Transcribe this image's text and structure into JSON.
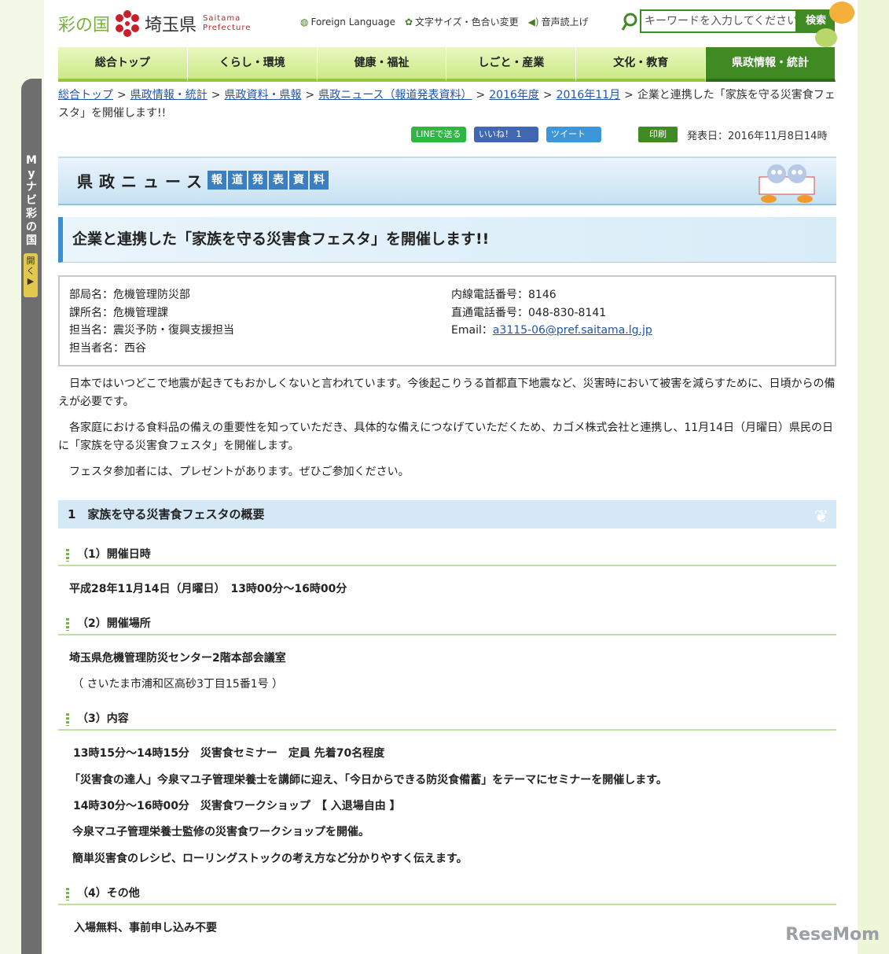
{
  "header": {
    "logo_sainokuni": "彩の国",
    "logo_ken": "埼玉県",
    "logo_en_1": "Saitama",
    "logo_en_2": "Prefecture",
    "util_foreign": "Foreign Language",
    "util_font": "文字サイズ・色合い変更",
    "util_voice": "音声読上げ",
    "search_placeholder": "キーワードを入力してください",
    "search_button": "検索"
  },
  "nav": [
    "総合トップ",
    "くらし・環境",
    "健康・福祉",
    "しごと・産業",
    "文化・教育",
    "県政情報・統計"
  ],
  "side_tab": {
    "label": "Myナビ 彩の国",
    "open": "開く▶"
  },
  "breadcrumb": {
    "items": [
      "総合トップ",
      "県政情報・統計",
      "県政資料・県報",
      "県政ニュース（報道発表資料）",
      "2016年度",
      "2016年11月"
    ],
    "current": "企業と連携した「家族を守る災害食フェスタ」を開催します!!"
  },
  "share": {
    "line": "LINEで送る",
    "fb": "いいね！ 1",
    "tw": "ツイート",
    "print": "印刷",
    "pubdate": "発表日：2016年11月8日14時"
  },
  "banner": {
    "kensei": "県政ニュース",
    "houdou": [
      "報",
      "道",
      "発",
      "表",
      "資",
      "料"
    ]
  },
  "title": "企業と連携した「家族を守る災害食フェスタ」を開催します!!",
  "contact": {
    "dept": "部局名：危機管理防災部",
    "section": "課所名：危機管理課",
    "team": "担当名：震災予防・復興支援担当",
    "person": "担当者名：西谷",
    "ext": "内線電話番号：8146",
    "direct": "直通電話番号：048-830-8141",
    "email_label": "Email：",
    "email": "a3115-06@pref.saitama.lg.jp"
  },
  "body": {
    "p1": "日本ではいつどこで地震が起きてもおかしくないと言われています。今後起こりうる首都直下地震など、災害時において被害を減らすために、日頃からの備えが必要です。",
    "p2": "各家庭における食料品の備えの重要性を知っていただき、具体的な備えにつなげていただくため、カゴメ株式会社と連携し、11月14日（月曜日）県民の日に「家族を守る災害食フェスタ」を開催します。",
    "p3": "フェスタ参加者には、プレゼントがあります。ぜひご参加ください。"
  },
  "section1": {
    "heading": "1　家族を守る災害食フェスタの概要",
    "h_date": "（1）開催日時",
    "date": "平成28年11月14日（月曜日）　13時00分～16時00分",
    "h_place": "（2）開催場所",
    "place": "埼玉県危機管理防災センター2階本部会議室",
    "address": "（ さいたま市浦和区高砂3丁目15番1号 ）",
    "h_content": "（3）内容",
    "c1": "13時15分～14時15分　災害食セミナー　定員 先着70名程度",
    "c2": "「災害食の達人」今泉マユ子管理栄養士を講師に迎え、「今日からできる防災食備蓄」をテーマにセミナーを開催します。",
    "c3": "14時30分～16時00分　災害食ワークショップ　【 入退場自由 】",
    "c4": "今泉マユ子管理栄養士監修の災害食ワークショップを開催。",
    "c5": "簡単災害食のレシピ、ローリングストックの考え方など分かりやすく伝えます。",
    "h_other": "（4）その他",
    "other": "入場無料、事前申し込み不要"
  },
  "watermark": "ReseMom"
}
